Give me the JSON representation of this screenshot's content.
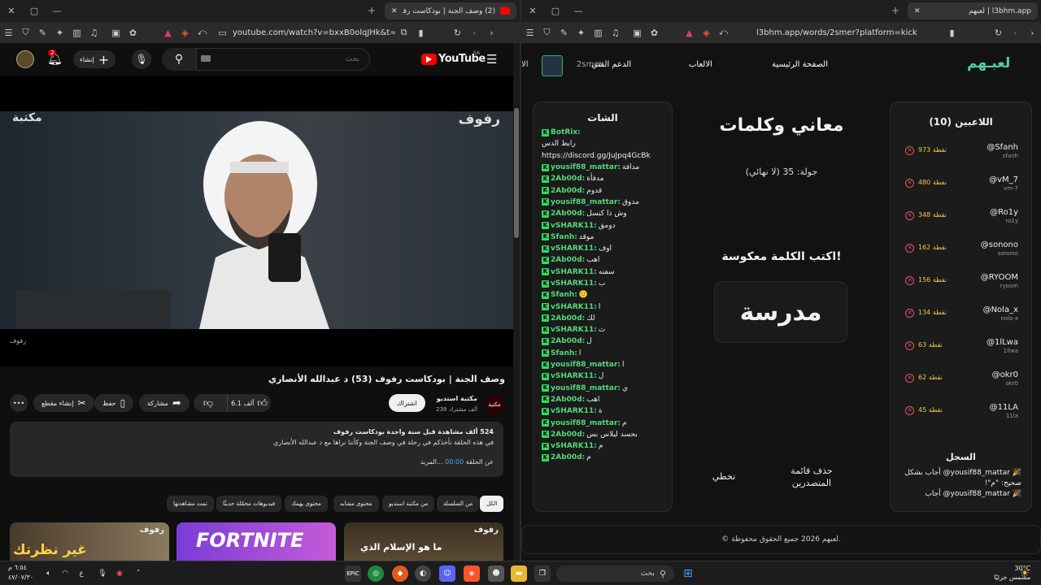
{
  "left": {
    "tab_title": "(2) وصف الجنة | بودكاست رفوف",
    "url": "youtube.com/watch?v=bxxB0olqJHk&t=2...",
    "yt": {
      "logo": "YouTube",
      "country": "SA",
      "search_placeholder": "بحث",
      "create_label": "إنشاء",
      "notif_count": "2",
      "video_overlay_brand": "رفوف",
      "video_caption": "رفوف",
      "channel_badge": "مكتبة",
      "title": "وصف الجنة | بودكاست رفوف (53) د عبدالله الأنصاري",
      "channel_name": "مكتبة استديو",
      "subscribers": "238 ألف مشترك",
      "subscribe_label": "اشتراك",
      "likes": "6.1 ألف",
      "share": "مشاركة",
      "save": "حفظ",
      "clip": "إنشاء مقطع",
      "desc_meta": "524 ألف مشاهدة  قبل سنة واحدة  بودكاست رفوف",
      "desc_line": "في هذه الحلقة نأخذكم في رحلة في وصف الجنة وكأننا نراها مع د عبدالله الأنصاري",
      "desc_more": "...المزيد",
      "desc_episode": "عن الحلقة",
      "desc_link": "00:00",
      "chips": [
        "الكل",
        "من السلسلة",
        "من مكتبة استديو",
        "محتوى مشابه",
        "محتوى يهمك",
        "فيديوهات محمّلة حديثًا",
        "تمت مشاهدتها"
      ],
      "thumb1_text": "ما هو الإسلام الذي",
      "thumb1_brand": "رفوف",
      "thumb2_text": "FORTNITE",
      "thumb3_text": "غير نظرتك",
      "thumb3_brand": "رفوف"
    }
  },
  "right": {
    "tab_title": "لعبهم | l3bhm.app",
    "url": "l3bhm.app/words/2smer?platform=kick",
    "nav": {
      "logo": "لعبـهم",
      "home": "الصفحة الرئيسية",
      "games": "الالعاب",
      "support": "الدعم الفني",
      "user": "2smer",
      "more": "الا"
    },
    "players_title": "اللاعبين (10)",
    "players": [
      {
        "name": "@Sfanh",
        "sub": "sfanh",
        "pts": "973 نقطة"
      },
      {
        "name": "@vM_7",
        "sub": "vm-7",
        "pts": "480 نقطة"
      },
      {
        "name": "@Ro1y",
        "sub": "ro1y",
        "pts": "348 نقطة"
      },
      {
        "name": "@sonono",
        "sub": "sonono",
        "pts": "162 نقطة"
      },
      {
        "name": "@RYOOM",
        "sub": "ryoom",
        "pts": "156 نقطة"
      },
      {
        "name": "@Nola_x",
        "sub": "nola-x",
        "pts": "134 نقطة"
      },
      {
        "name": "@1lLwa",
        "sub": "1llwa",
        "pts": "63 نقطة"
      },
      {
        "name": "@okr0",
        "sub": "okr0",
        "pts": "62 نقطة"
      },
      {
        "name": "@11LA",
        "sub": "11la",
        "pts": "45 نقطة"
      }
    ],
    "log_title": "السجل",
    "log": [
      "🎉 yousif88_mattar@ أجاب بشكل صحيح: \"م\"!",
      "🎉 yousif88_mattar@ أجاب"
    ],
    "game": {
      "title": "معاني وكلمات",
      "round": "جولة: 35 (لا نهائي)",
      "prompt": "اكتب الكلمة معكوسة!",
      "word": "مدرسة",
      "clear_label": "حذف قائمة المتصدرين",
      "skip_label": "تخطي"
    },
    "chat_title": "الشات",
    "chat": [
      {
        "u": "BotRix:",
        "m": ""
      },
      {
        "u": "",
        "m": "رابط الدس"
      },
      {
        "u": "",
        "m": "https://discord.gg/JuJpq4GcBk"
      },
      {
        "u": "yousif88_mattar:",
        "m": "مدافة"
      },
      {
        "u": "2Ab00d:",
        "m": "مدفأة"
      },
      {
        "u": "2Ab00d:",
        "m": "قدوم"
      },
      {
        "u": "yousif88_mattar:",
        "m": "مدوق"
      },
      {
        "u": "2Ab00d:",
        "m": "وش ذا كنسل"
      },
      {
        "u": "vSHARK11:",
        "m": "دومق"
      },
      {
        "u": "Sfanh:",
        "m": "موقد"
      },
      {
        "u": "vSHARK11:",
        "m": "اوف"
      },
      {
        "u": "2Ab00d:",
        "m": "اهب"
      },
      {
        "u": "vSHARK11:",
        "m": "سفنه"
      },
      {
        "u": "vSHARK11:",
        "m": "ب"
      },
      {
        "u": "Sfanh:",
        "m": "🙂"
      },
      {
        "u": "vSHARK11:",
        "m": "ا"
      },
      {
        "u": "2Ab00d:",
        "m": "لك"
      },
      {
        "u": "vSHARK11:",
        "m": "ث"
      },
      {
        "u": "2Ab00d:",
        "m": "ل"
      },
      {
        "u": "Sfanh:",
        "m": "ا"
      },
      {
        "u": "yousif88_mattar:",
        "m": "ا"
      },
      {
        "u": "vSHARK11:",
        "m": "ل"
      },
      {
        "u": "yousif88_mattar:",
        "m": "ي"
      },
      {
        "u": "2Ab00d:",
        "m": "اهب"
      },
      {
        "u": "vSHARK11:",
        "m": "ة"
      },
      {
        "u": "yousif88_mattar:",
        "m": "م"
      },
      {
        "u": "2Ab00d:",
        "m": "بحسد ليلاس بس"
      },
      {
        "u": "vSHARK11:",
        "m": "م"
      },
      {
        "u": "2Ab00d:",
        "m": "م"
      }
    ],
    "footer": "© لعبهم 2026 جميع الحقوق محفوظة."
  },
  "taskbar": {
    "search": "بحث",
    "weather_temp": "30°C",
    "weather_desc": "مشمس جزئيًا",
    "time": "٦:٥٤ م",
    "date": "٤٧/٠٧/٣٠",
    "lang": "ع"
  },
  "colors": {
    "kick_green": "#53d87b",
    "points_gold": "#f0c94a",
    "yt_red": "#ff0000"
  }
}
